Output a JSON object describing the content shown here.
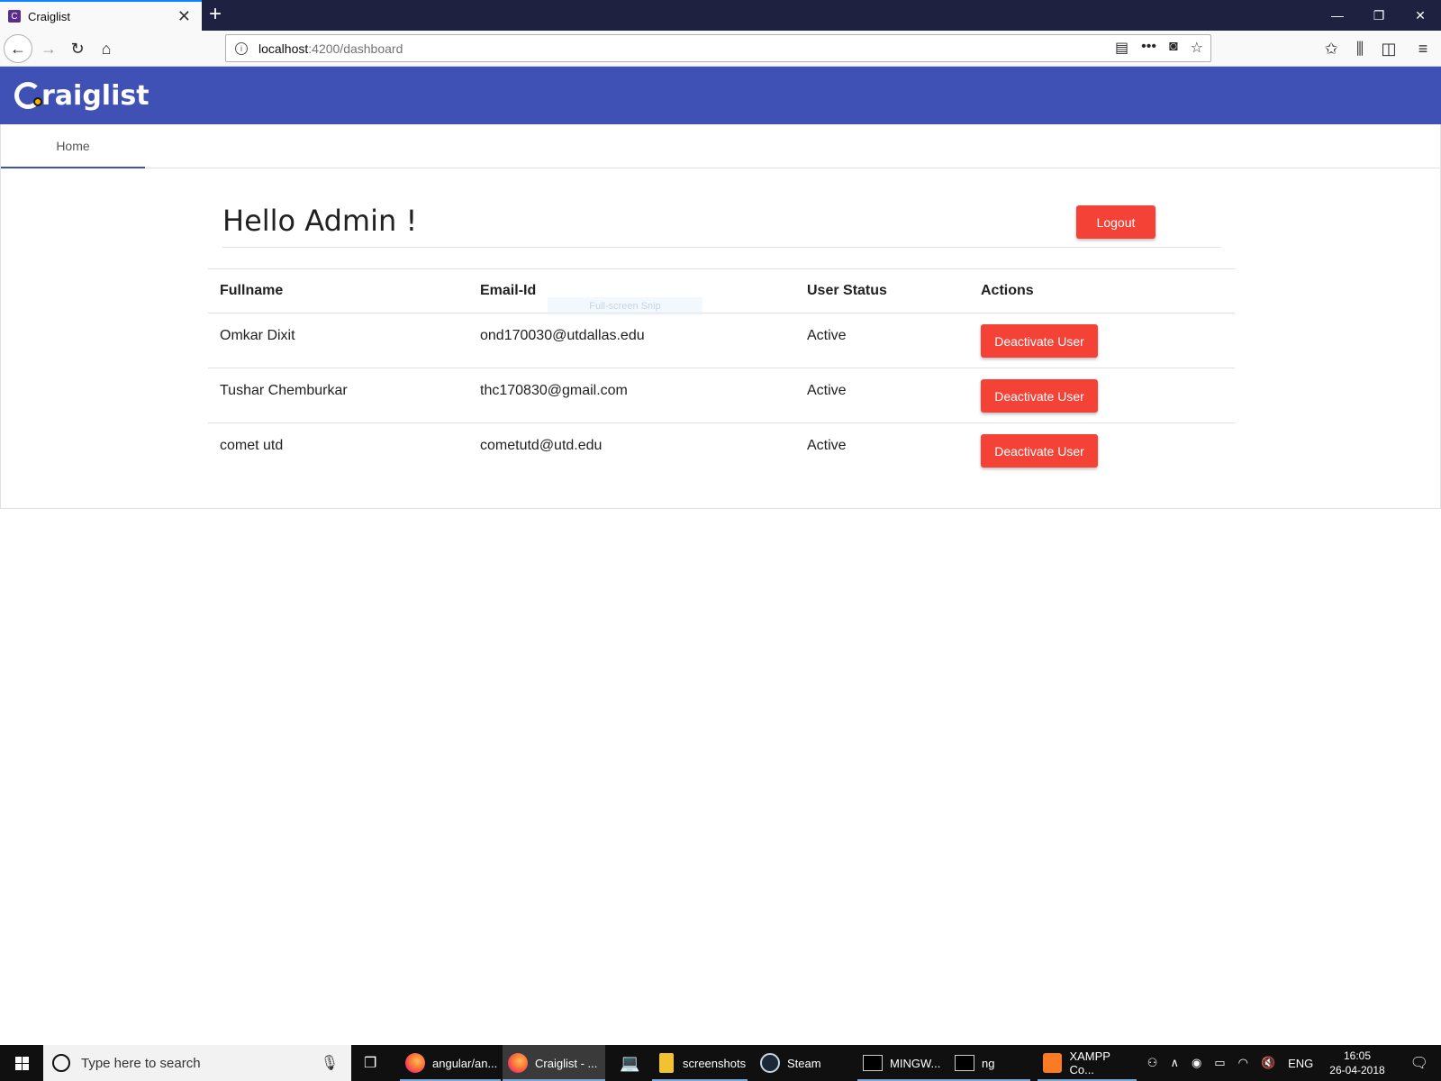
{
  "browser": {
    "tab_title": "Craiglist",
    "tab_favicon_letter": "C",
    "url_host": "localhost",
    "url_rest": ":4200/dashboard"
  },
  "app": {
    "logo_text": "raiglist",
    "nav_tabs": [
      {
        "label": "Home"
      }
    ],
    "greeting": "Hello Admin !",
    "logout_label": "Logout"
  },
  "table": {
    "headers": [
      "Fullname",
      "Email-Id",
      "User Status",
      "Actions"
    ],
    "rows": [
      {
        "fullname": "Omkar Dixit",
        "email": "ond170030@utdallas.edu",
        "status": "Active",
        "action": "Deactivate User"
      },
      {
        "fullname": "Tushar Chemburkar",
        "email": "thc170830@gmail.com",
        "status": "Active",
        "action": "Deactivate User"
      },
      {
        "fullname": "comet utd",
        "email": "cometutd@utd.edu",
        "status": "Active",
        "action": "Deactivate User"
      }
    ]
  },
  "overlay": {
    "snip_hint": "Full-screen Snip"
  },
  "taskbar": {
    "search_placeholder": "Type here to search",
    "items": [
      {
        "label": "angular/an...",
        "icon": "firefox-icon"
      },
      {
        "label": "Craiglist - ...",
        "icon": "firefox-icon"
      },
      {
        "label": "",
        "icon": "laptop-icon"
      },
      {
        "label": "screenshots",
        "icon": "folder-icon"
      },
      {
        "label": "Steam",
        "icon": "steam-icon"
      },
      {
        "label": "MINGW...",
        "icon": "terminal-icon"
      },
      {
        "label": "ng",
        "icon": "terminal-icon"
      },
      {
        "label": "XAMPP Co...",
        "icon": "xampp-icon"
      }
    ],
    "language": "ENG",
    "time": "16:05",
    "date": "26-04-2018"
  },
  "colors": {
    "app_bar": "#3f51b5",
    "button_red": "#f44336",
    "tab_indicator": "#3f51b5"
  }
}
